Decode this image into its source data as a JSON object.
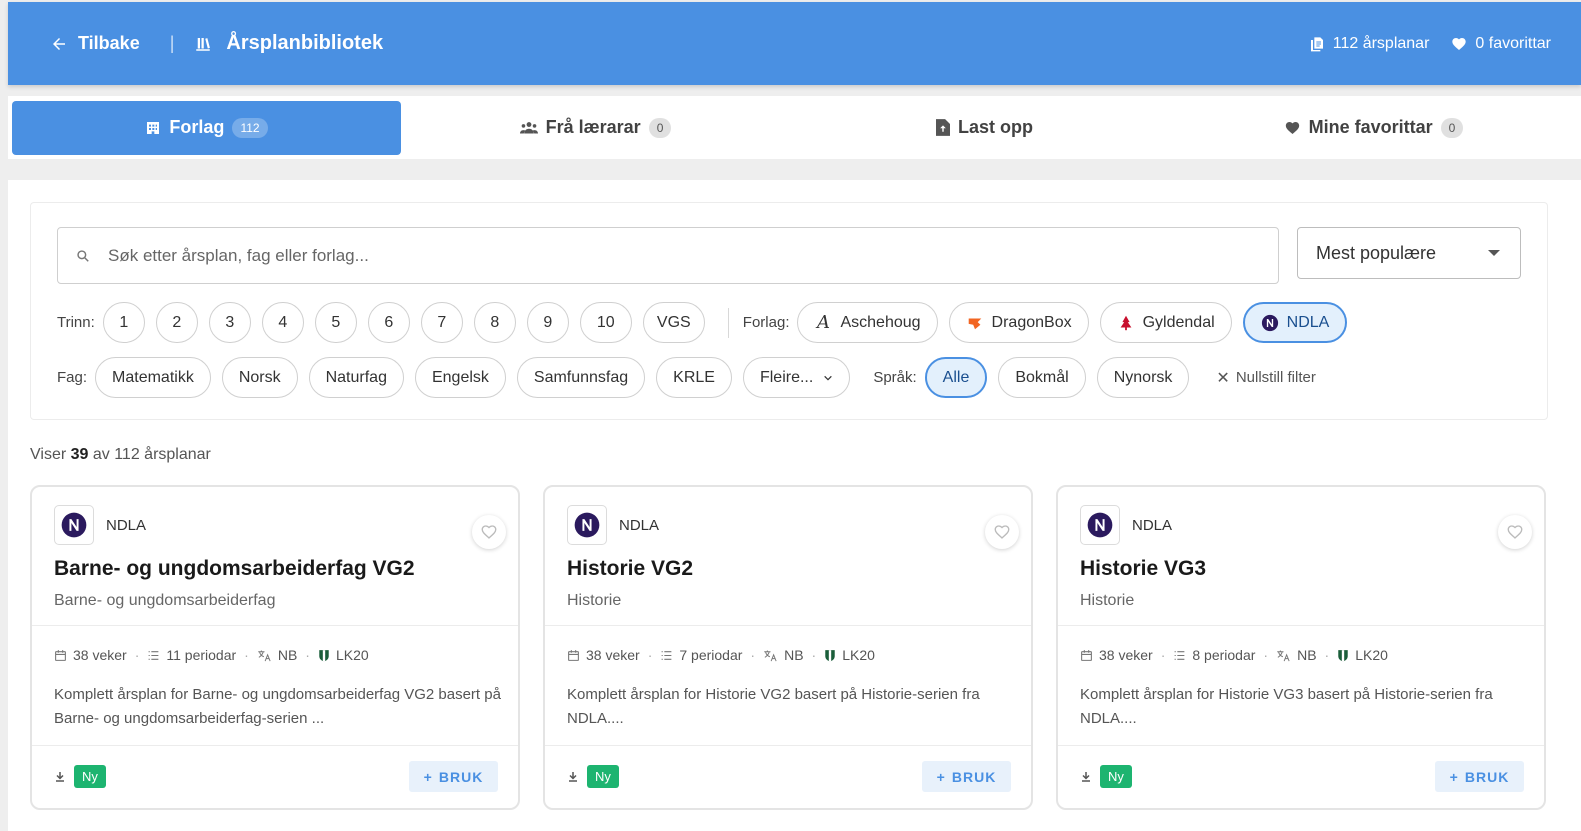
{
  "header": {
    "back_label": "Tilbake",
    "separator": "|",
    "title": "Årsplanbibliotek",
    "plans_count": "112 årsplanar",
    "favorites_count": "0 favorittar"
  },
  "tabs": [
    {
      "label": "Forlag",
      "count": "112"
    },
    {
      "label": "Frå lærarar",
      "count": "0"
    },
    {
      "label": "Last opp",
      "count": ""
    },
    {
      "label": "Mine favorittar",
      "count": "0"
    }
  ],
  "search": {
    "placeholder": "Søk etter årsplan, fag eller forlag..."
  },
  "sort": {
    "selected": "Mest populære"
  },
  "filters": {
    "trinn_label": "Trinn:",
    "trinn": [
      "1",
      "2",
      "3",
      "4",
      "5",
      "6",
      "7",
      "8",
      "9",
      "10",
      "VGS"
    ],
    "forlag_label": "Forlag:",
    "forlag": [
      "Aschehoug",
      "DragonBox",
      "Gyldendal",
      "NDLA"
    ],
    "fag_label": "Fag:",
    "fag": [
      "Matematikk",
      "Norsk",
      "Naturfag",
      "Engelsk",
      "Samfunnsfag",
      "KRLE"
    ],
    "fag_more": "Fleire...",
    "sprak_label": "Språk:",
    "sprak": [
      "Alle",
      "Bokmål",
      "Nynorsk"
    ],
    "reset_label": "Nullstill filter"
  },
  "results": {
    "prefix": "Viser",
    "shown": "39",
    "middle": "av 112 årsplanar"
  },
  "cards": [
    {
      "publisher": "NDLA",
      "title": "Barne- og ungdomsarbeiderfag VG2",
      "subject": "Barne- og ungdomsarbeiderfag",
      "weeks": "38 veker",
      "periods": "11 periodar",
      "lang": "NB",
      "curriculum": "LK20",
      "description": "Komplett årsplan for Barne- og ungdomsarbeiderfag VG2 basert på Barne- og ungdomsarbeiderfag-serien ...",
      "badge": "Ny",
      "action": "BRUK"
    },
    {
      "publisher": "NDLA",
      "title": "Historie VG2",
      "subject": "Historie",
      "weeks": "38 veker",
      "periods": "7 periodar",
      "lang": "NB",
      "curriculum": "LK20",
      "description": "Komplett årsplan for Historie VG2 basert på Historie-serien fra NDLA....",
      "badge": "Ny",
      "action": "BRUK"
    },
    {
      "publisher": "NDLA",
      "title": "Historie VG3",
      "subject": "Historie",
      "weeks": "38 veker",
      "periods": "8 periodar",
      "lang": "NB",
      "curriculum": "LK20",
      "description": "Komplett årsplan for Historie VG3 basert på Historie-serien fra NDLA....",
      "badge": "Ny",
      "action": "BRUK"
    }
  ],
  "colors": {
    "primary": "#4a90e2",
    "badge_new": "#1db470",
    "ndla": "#2b1a5e"
  }
}
